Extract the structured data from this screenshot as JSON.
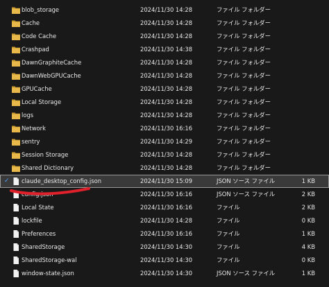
{
  "files": [
    {
      "name": "blob_storage",
      "date": "2024/11/30 14:28",
      "type": "ファイル フォルダー",
      "size": "",
      "kind": "folder"
    },
    {
      "name": "Cache",
      "date": "2024/11/30 14:28",
      "type": "ファイル フォルダー",
      "size": "",
      "kind": "folder"
    },
    {
      "name": "Code Cache",
      "date": "2024/11/30 14:28",
      "type": "ファイル フォルダー",
      "size": "",
      "kind": "folder"
    },
    {
      "name": "Crashpad",
      "date": "2024/11/30 14:38",
      "type": "ファイル フォルダー",
      "size": "",
      "kind": "folder"
    },
    {
      "name": "DawnGraphiteCache",
      "date": "2024/11/30 14:28",
      "type": "ファイル フォルダー",
      "size": "",
      "kind": "folder"
    },
    {
      "name": "DawnWebGPUCache",
      "date": "2024/11/30 14:28",
      "type": "ファイル フォルダー",
      "size": "",
      "kind": "folder"
    },
    {
      "name": "GPUCache",
      "date": "2024/11/30 14:28",
      "type": "ファイル フォルダー",
      "size": "",
      "kind": "folder"
    },
    {
      "name": "Local Storage",
      "date": "2024/11/30 14:28",
      "type": "ファイル フォルダー",
      "size": "",
      "kind": "folder"
    },
    {
      "name": "logs",
      "date": "2024/11/30 14:28",
      "type": "ファイル フォルダー",
      "size": "",
      "kind": "folder"
    },
    {
      "name": "Network",
      "date": "2024/11/30 16:16",
      "type": "ファイル フォルダー",
      "size": "",
      "kind": "folder"
    },
    {
      "name": "sentry",
      "date": "2024/11/30 14:29",
      "type": "ファイル フォルダー",
      "size": "",
      "kind": "folder"
    },
    {
      "name": "Session Storage",
      "date": "2024/11/30 14:28",
      "type": "ファイル フォルダー",
      "size": "",
      "kind": "folder"
    },
    {
      "name": "Shared Dictionary",
      "date": "2024/11/30 14:28",
      "type": "ファイル フォルダー",
      "size": "",
      "kind": "folder"
    },
    {
      "name": "claude_desktop_config.json",
      "date": "2024/11/30 15:09",
      "type": "JSON ソース ファイル",
      "size": "1 KB",
      "kind": "file",
      "selected": true
    },
    {
      "name": "config.json",
      "date": "2024/11/30 16:16",
      "type": "JSON ソース ファイル",
      "size": "2 KB",
      "kind": "file"
    },
    {
      "name": "Local State",
      "date": "2024/11/30 16:16",
      "type": "ファイル",
      "size": "2 KB",
      "kind": "file"
    },
    {
      "name": "lockfile",
      "date": "2024/11/30 14:28",
      "type": "ファイル",
      "size": "0 KB",
      "kind": "file"
    },
    {
      "name": "Preferences",
      "date": "2024/11/30 16:16",
      "type": "ファイル",
      "size": "1 KB",
      "kind": "file"
    },
    {
      "name": "SharedStorage",
      "date": "2024/11/30 14:30",
      "type": "ファイル",
      "size": "4 KB",
      "kind": "file"
    },
    {
      "name": "SharedStorage-wal",
      "date": "2024/11/30 14:30",
      "type": "ファイル",
      "size": "0 KB",
      "kind": "file"
    },
    {
      "name": "window-state.json",
      "date": "2024/11/30 14:30",
      "type": "JSON ソース ファイル",
      "size": "1 KB",
      "kind": "file"
    }
  ],
  "colors": {
    "folder": "#e8b84a",
    "folder_dark": "#c99a2e",
    "file": "#f2f2f2",
    "selection_border": "#9a9a9a",
    "annotation": "#e0202a",
    "check": "#4aa0ff"
  },
  "icons": {
    "check": "✓"
  }
}
